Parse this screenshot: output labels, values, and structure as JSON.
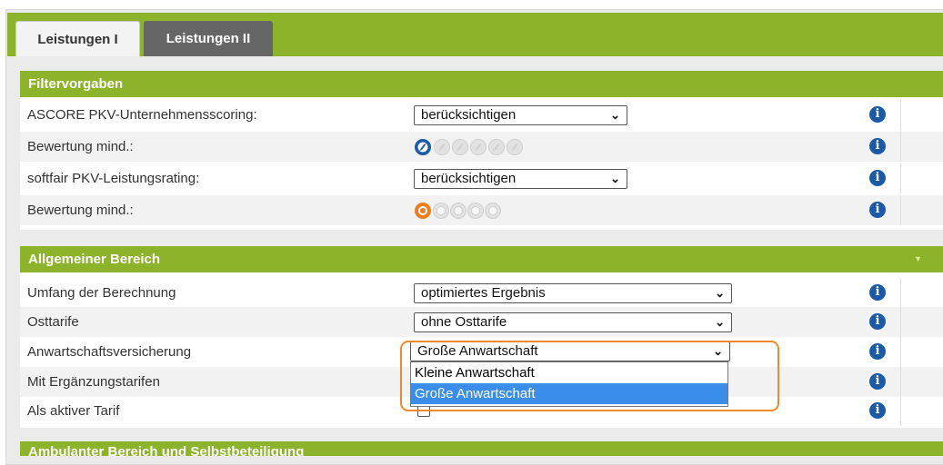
{
  "tabs": [
    {
      "label": "Leistungen I",
      "active": true
    },
    {
      "label": "Leistungen II",
      "active": false
    }
  ],
  "colors": {
    "accent": "#8db32b",
    "info": "#1b5aa6",
    "highlight": "#ee8a2a",
    "selected_option": "#3a8eea"
  },
  "filter": {
    "header": "Filtervorgaben",
    "rows": [
      {
        "label": "ASCORE PKV-Unternehmensscoring:",
        "select": "berücksichtigen"
      },
      {
        "label": "Bewertung mind.:",
        "rating": {
          "selected": 1,
          "max": 6,
          "icon": "compass-icon"
        }
      },
      {
        "label": "softfair PKV-Leistungsrating:",
        "select": "berücksichtigen"
      },
      {
        "label": "Bewertung mind.:",
        "rating": {
          "selected": 1,
          "max": 5,
          "icon": "circle-icon"
        }
      }
    ]
  },
  "general": {
    "header": "Allgemeiner Bereich",
    "rows": [
      {
        "label": "Umfang der Berechnung",
        "select": "optimiertes Ergebnis"
      },
      {
        "label": "Osttarife",
        "select": "ohne Osttarife"
      },
      {
        "label": "Anwartschaftsversicherung",
        "select": "Große Anwartschaft"
      },
      {
        "label": "Mit Ergänzungstarifen"
      },
      {
        "label": "Als aktiver Tarif",
        "checkbox": false
      }
    ],
    "dropdown_options": [
      "Kleine Anwartschaft",
      "Große Anwartschaft"
    ],
    "dropdown_selected": "Große Anwartschaft"
  },
  "bottom_header": "Ambulanter Bereich und Selbstbeteiligung",
  "info_glyph": "i",
  "chevron_glyph": "⌄"
}
